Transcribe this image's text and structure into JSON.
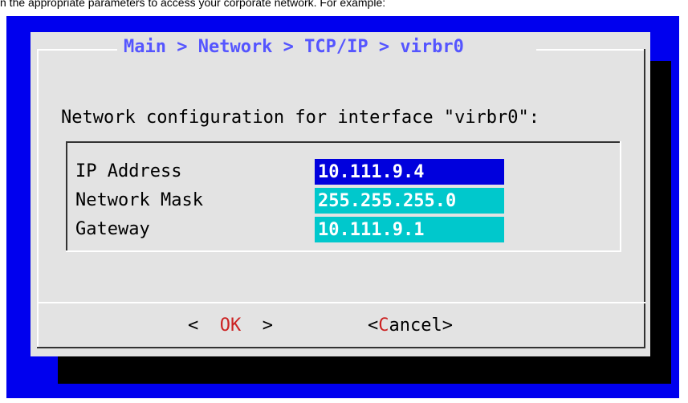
{
  "doc_line": "n the appropriate parameters to access your corporate network. For example:",
  "dialog": {
    "title": "Main > Network > TCP/IP > virbr0",
    "prompt": "Network configuration for interface \"virbr0\":",
    "fields": [
      {
        "label": "IP Address",
        "value": "10.111.9.4",
        "active": true
      },
      {
        "label": "Network Mask",
        "value": "255.255.255.0",
        "active": false
      },
      {
        "label": "Gateway",
        "value": "10.111.9.1",
        "active": false
      }
    ],
    "buttons": {
      "ok_left": "<  ",
      "ok_hot": "OK",
      "ok_right": "  >",
      "cancel_left": "<",
      "cancel_hot": "C",
      "cancel_rest": "ancel",
      "cancel_right": ">"
    }
  },
  "colors": {
    "terminal_bg": "#0000ee",
    "dialog_bg": "#e3e3e3",
    "title": "#5555ff",
    "active_field": "#0000dd",
    "inactive_field": "#00c8cc",
    "hotkey": "#cc2222"
  }
}
